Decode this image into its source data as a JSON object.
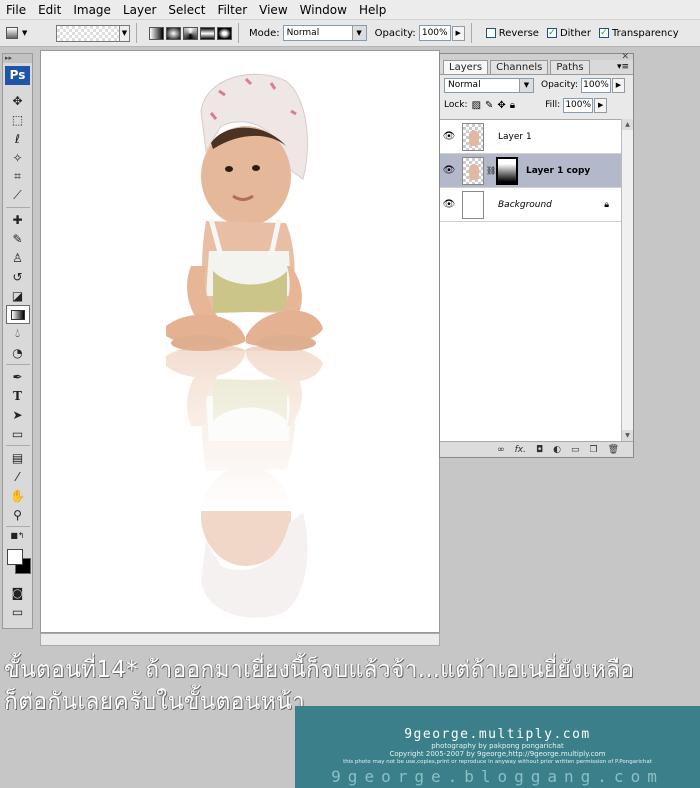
{
  "menu": [
    "File",
    "Edit",
    "Image",
    "Layer",
    "Select",
    "Filter",
    "View",
    "Window",
    "Help"
  ],
  "options": {
    "mode_label": "Mode:",
    "mode_value": "Normal",
    "opacity_label": "Opacity:",
    "opacity_value": "100%",
    "reverse_label": "Reverse",
    "reverse_checked": false,
    "dither_label": "Dither",
    "dither_checked": true,
    "transparency_label": "Transparency",
    "transparency_checked": true
  },
  "toolbox": {
    "logo": "Ps",
    "active_tool": "gradient-tool",
    "tool_icons": [
      "move-icon",
      "marquee-icon",
      "lasso-icon",
      "magic-wand-icon",
      "crop-icon",
      "slice-icon",
      "healing-brush-icon",
      "brush-icon",
      "clone-stamp-icon",
      "history-brush-icon",
      "eraser-icon",
      "gradient-icon",
      "blur-icon",
      "dodge-icon",
      "pen-icon",
      "type-icon",
      "path-selection-icon",
      "shape-icon",
      "notes-icon",
      "eyedropper-icon",
      "hand-icon",
      "zoom-icon"
    ],
    "foreground_color": "#ffffff",
    "background_color": "#000000"
  },
  "layers_panel": {
    "tabs": [
      "Layers",
      "Channels",
      "Paths"
    ],
    "active_tab": "Layers",
    "blend_mode": "Normal",
    "opacity_label": "Opacity:",
    "opacity_value": "100%",
    "lock_label": "Lock:",
    "fill_label": "Fill:",
    "fill_value": "100%",
    "layers": [
      {
        "name": "Layer 1",
        "visible": true,
        "selected": false
      },
      {
        "name": "Layer 1 copy",
        "visible": true,
        "selected": true,
        "has_mask": true
      },
      {
        "name": "Background",
        "visible": true,
        "selected": false,
        "locked": true
      }
    ],
    "footer_icons": [
      "link-icon",
      "fx-icon",
      "mask-icon",
      "adjustment-icon",
      "folder-icon",
      "new-layer-icon",
      "trash-icon"
    ]
  },
  "caption": {
    "line1": "ขั้นตอนที่14* ถ้าออกมาเยี่ยงนี้ก็จบแล้วจ้า...แต่ถ้าเอเนยี่ยังเหลือ",
    "line2": "ก็ต่อกันเลยครับในขั้นตอนหน้า"
  },
  "watermark": {
    "title": "9george.multiply.com",
    "line1": "photography by pakpong pongarichat",
    "line2": "Copyright 2005-2007 by 9george,http://9george.multiply.com",
    "line3": "this photo may not be use,copies,print or reproduce in anyway without prior written permission of P.Pongarichat",
    "bottom": "9george.bloggang.com"
  }
}
